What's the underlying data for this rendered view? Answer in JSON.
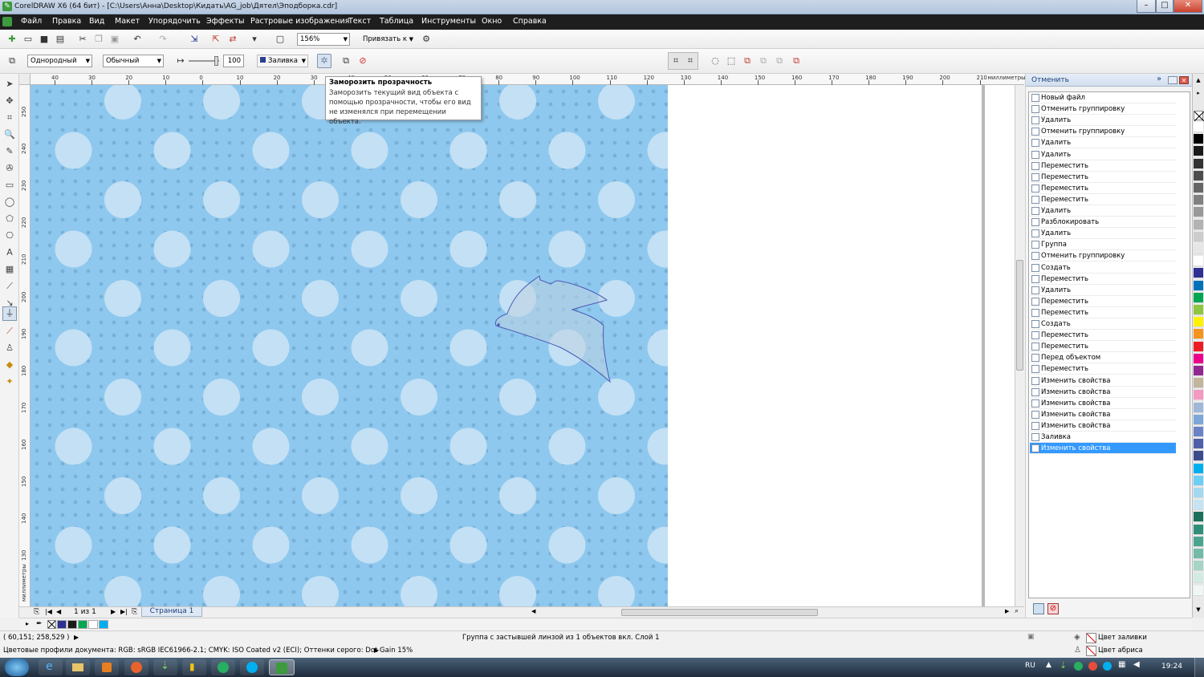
{
  "window": {
    "title": "CorelDRAW X6 (64 бит) - [C:\\Users\\Анна\\Desktop\\Кидать\\AG_job\\Дятел\\Эподборка.cdr]",
    "minimize": "–",
    "maximize": "□",
    "close": "✕"
  },
  "menu": [
    "Файл",
    "Правка",
    "Вид",
    "Макет",
    "Упорядочить",
    "Эффекты",
    "Растровые изображения",
    "Текст",
    "Таблица",
    "Инструменты",
    "Окно",
    "Справка"
  ],
  "toolbar": {
    "zoom": "156%",
    "snap": "Привязать к"
  },
  "propbar": {
    "transparency_type": "Однородный",
    "merge_mode": "Обычный",
    "transparency_value": "100",
    "target": "Заливка"
  },
  "tooltip": {
    "title": "Заморозить прозрачность",
    "body": "Заморозить текущий вид объекта с помощью прозрачности, чтобы его вид не изменялся при перемещении объекта."
  },
  "ruler": {
    "h_labels": [
      "40",
      "30",
      "20",
      "10",
      "0",
      "10",
      "20",
      "30",
      "40",
      "50",
      "60",
      "70",
      "80",
      "90",
      "100",
      "110",
      "120",
      "130",
      "140",
      "150",
      "160",
      "170",
      "180",
      "190",
      "200",
      "210"
    ],
    "unit": "миллиметры",
    "v_labels": [
      "250",
      "240",
      "230",
      "220",
      "210",
      "200",
      "190",
      "180",
      "170",
      "160",
      "150",
      "140",
      "130"
    ],
    "v_unit": "миллиметры"
  },
  "docker": {
    "title": "Отменить",
    "items": [
      "Новый файл",
      "Отменить группировку",
      "Удалить",
      "Отменить группировку",
      "Удалить",
      "Удалить",
      "Переместить",
      "Переместить",
      "Переместить",
      "Переместить",
      "Удалить",
      "Разблокировать",
      "Удалить",
      "Группа",
      "Отменить группировку",
      "Создать",
      "Переместить",
      "Удалить",
      "Переместить",
      "Переместить",
      "Создать",
      "Переместить",
      "Переместить",
      "Перед объектом",
      "Переместить",
      "Изменить свойства",
      "Изменить свойства",
      "Изменить свойства",
      "Изменить свойства",
      "Изменить свойства",
      "Заливка",
      "Изменить свойства"
    ],
    "selected_index": 31
  },
  "navigator": {
    "page_count": "1 из 1",
    "page_tab": "Страница 1"
  },
  "palette_colors": [
    "#ffffff",
    "#000000",
    "#1a1a1a",
    "#333333",
    "#4d4d4d",
    "#666666",
    "#808080",
    "#999999",
    "#b3b3b3",
    "#cccccc",
    "#e6e6e6",
    "#ffffff",
    "#2e3192",
    "#0072bc",
    "#00a651",
    "#8dc63f",
    "#fff200",
    "#f7941d",
    "#ed1c24",
    "#ec008c",
    "#92278f",
    "#c2b59b",
    "#f49ac1",
    "#a0b8d8",
    "#7da7d9",
    "#6a82c6",
    "#4f5fa8",
    "#3b4b8c",
    "#00aeef",
    "#6dcff6",
    "#a3d9f0",
    "#c4e4f3",
    "#1b6f5c",
    "#2f8f7a",
    "#4aa58f",
    "#73bba8",
    "#a6d4c6",
    "#d2ebe3",
    "#f0f8f5"
  ],
  "doc_palette": [
    "#2e3192",
    "#1a1a1a",
    "#00a651",
    "#ffffff",
    "#00aeef"
  ],
  "status": {
    "coords": "( 60,151; 258,529 )",
    "selection": "Группа с застывшей линзой из 1 объектов вкл. Слой 1",
    "profiles": "Цветовые профили документа: RGB: sRGB IEC61966-2.1; CMYK: ISO Coated v2 (ECI); Оттенки серого: Dot Gain 15%",
    "fill_label": "Цвет заливки",
    "outline_label": "Цвет абриса"
  },
  "taskbar": {
    "lang": "RU",
    "time": "19:24"
  }
}
